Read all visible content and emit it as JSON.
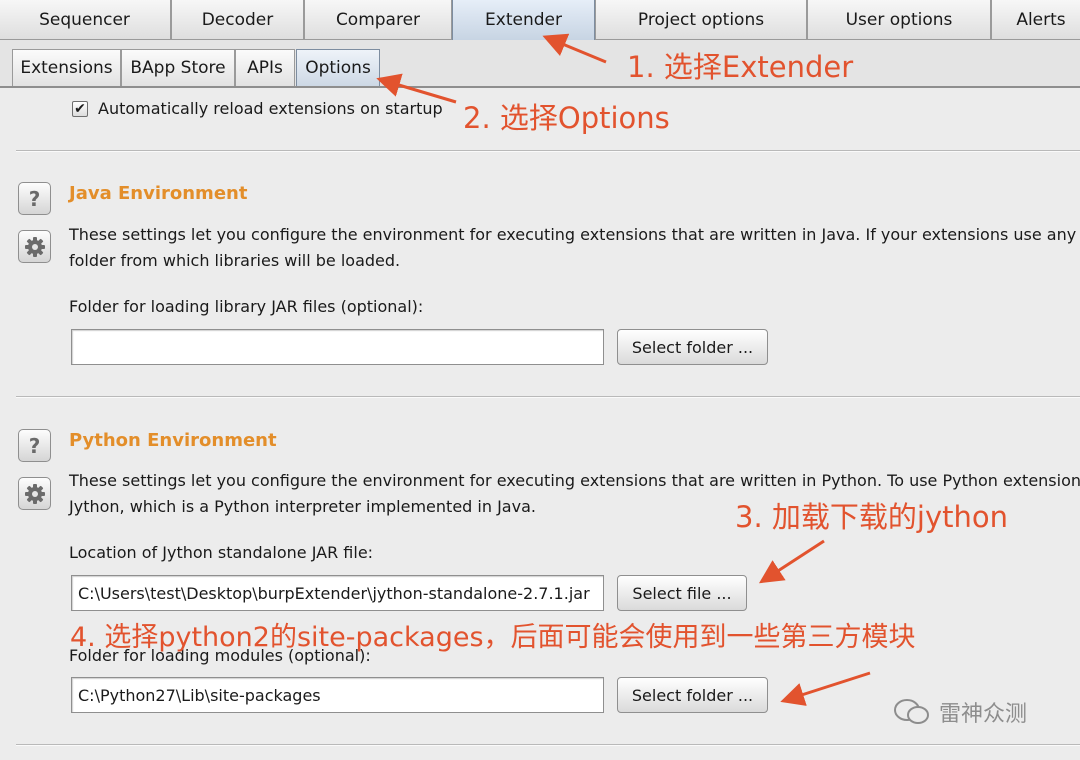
{
  "top_tabs": [
    {
      "label": "Sequencer"
    },
    {
      "label": "Decoder"
    },
    {
      "label": "Comparer"
    },
    {
      "label": "Extender"
    },
    {
      "label": "Project options"
    },
    {
      "label": "User options"
    },
    {
      "label": "Alerts"
    }
  ],
  "sub_tabs": [
    {
      "label": "Extensions"
    },
    {
      "label": "BApp Store"
    },
    {
      "label": "APIs"
    },
    {
      "label": "Options"
    }
  ],
  "auto_reload": {
    "label": "Automatically reload extensions on startup",
    "checked": true
  },
  "java": {
    "title": "Java Environment",
    "desc_line1": "These settings let you configure the environment for executing extensions that are written in Java. If your extensions use any libra",
    "desc_line2": "folder from which libraries will be loaded.",
    "field_label": "Folder for loading library JAR files (optional):",
    "field_value": "",
    "button_label": "Select folder ..."
  },
  "python": {
    "title": "Python Environment",
    "desc_line1": "These settings let you configure the environment for executing extensions that are written in Python. To use Python extensions, y",
    "desc_line2": "Jython, which is a Python interpreter implemented in Java.",
    "jython_label": "Location of Jython standalone JAR file:",
    "jython_value": "C:\\Users\\test\\Desktop\\burpExtender\\jython-standalone-2.7.1.jar",
    "jython_button": "Select file ...",
    "modules_label": "Folder for loading modules (optional):",
    "modules_value": "C:\\Python27\\Lib\\site-packages",
    "modules_button": "Select folder ..."
  },
  "side_icons": {
    "help": "help-icon",
    "settings": "gear-icon"
  },
  "annotations": {
    "step1": "1. 选择Extender",
    "step2": "2. 选择Options",
    "step3": "3. 加载下载的jython",
    "step4": "4. 选择python2的site-packages，后面可能会使用到一些第三方模块"
  },
  "watermark": "雷神众测",
  "colors": {
    "annotation": "#e2532e",
    "section_title": "#e38e2a",
    "active_tab": "#c7d4e3"
  }
}
